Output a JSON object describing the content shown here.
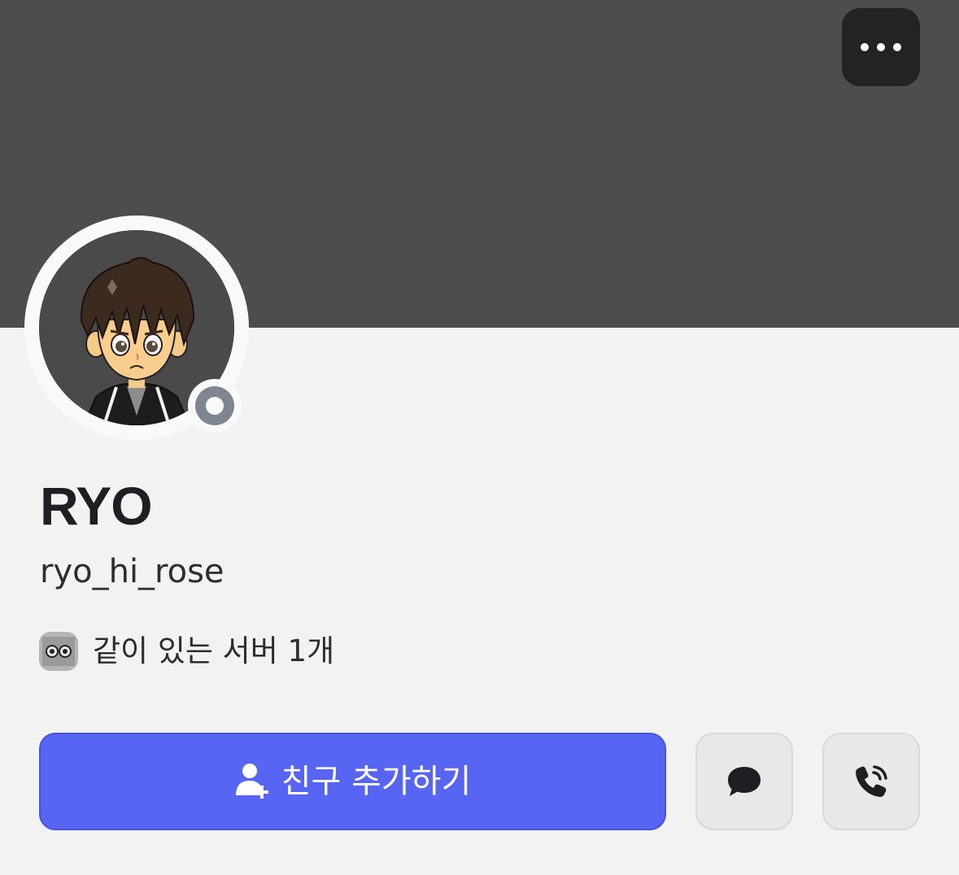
{
  "profile": {
    "display_name": "RYO",
    "username": "ryo_hi_rose",
    "status": "offline",
    "mutual_servers_text": "같이 있는 서버 1개"
  },
  "actions": {
    "add_friend_label": "친구 추가하기",
    "message_icon": "chat-bubble-icon",
    "call_icon": "phone-call-icon",
    "more_icon": "more-horizontal-icon"
  },
  "colors": {
    "banner": "#4d4d4d",
    "page_background": "#f2f2f3",
    "accent": "#5865f2",
    "status_offline": "#7f8690"
  }
}
